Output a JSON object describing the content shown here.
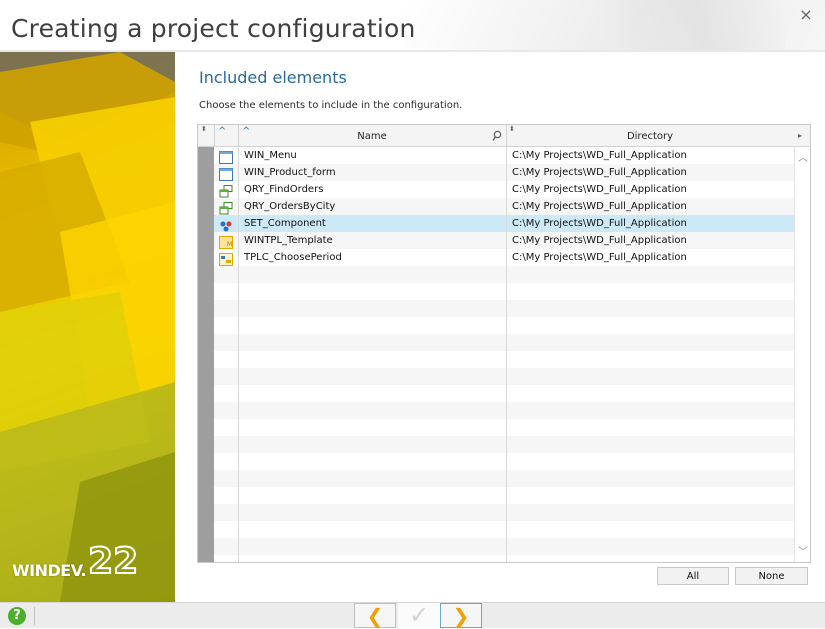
{
  "window": {
    "title": "Creating a project configuration",
    "close_glyph": "×"
  },
  "brand": {
    "name": "WINDEV.",
    "version": "22"
  },
  "page": {
    "section_title": "Included elements",
    "instructions": "Choose the elements to include in the configuration."
  },
  "table": {
    "columns": {
      "name": "Name",
      "directory": "Directory"
    },
    "rows": [
      {
        "checked": false,
        "icon": "window-icon",
        "name": "WIN_Menu",
        "directory": "C:\\My Projects\\WD_Full_Application"
      },
      {
        "checked": false,
        "icon": "window-icon",
        "name": "WIN_Product_form",
        "directory": "C:\\My Projects\\WD_Full_Application"
      },
      {
        "checked": true,
        "icon": "query-icon",
        "name": "QRY_FindOrders",
        "directory": "C:\\My Projects\\WD_Full_Application"
      },
      {
        "checked": false,
        "icon": "query-icon",
        "name": "QRY_OrdersByCity",
        "directory": "C:\\My Projects\\WD_Full_Application"
      },
      {
        "checked": true,
        "icon": "component-icon",
        "name": "SET_Component",
        "directory": "C:\\My Projects\\WD_Full_Application",
        "selected": true
      },
      {
        "checked": false,
        "icon": "template-icon",
        "name": "WINTPL_Template",
        "directory": "C:\\My Projects\\WD_Full_Application"
      },
      {
        "checked": false,
        "icon": "control-template-icon",
        "name": "TPLC_ChoosePeriod",
        "directory": "C:\\My Projects\\WD_Full_Application"
      }
    ]
  },
  "buttons": {
    "all": "All",
    "none": "None"
  },
  "footer": {
    "help_glyph": "?",
    "prev_glyph": "❮",
    "ok_glyph": "✓",
    "next_glyph": "❯"
  },
  "colors": {
    "title_blue": "#2a6a9a",
    "selected_row": "#cde8f7",
    "check_blue": "#1e7ed0",
    "help_green": "#4caf2a",
    "panel_yellow": "#f0c400"
  }
}
